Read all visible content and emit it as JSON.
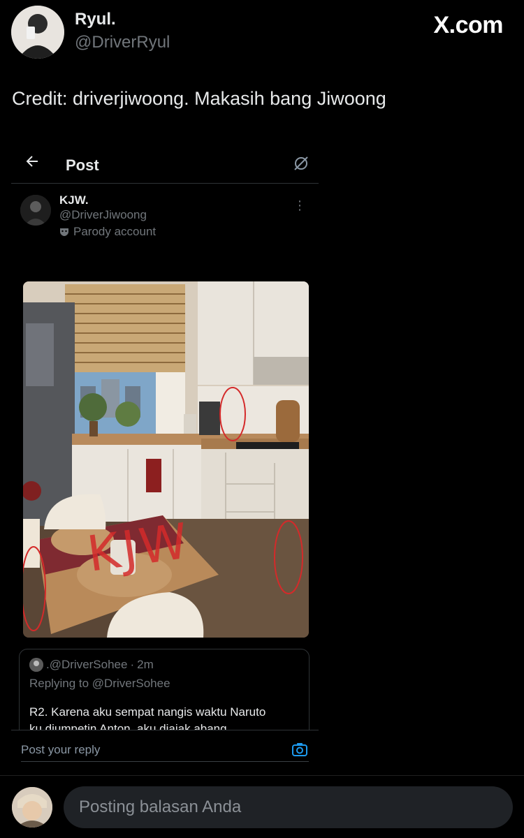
{
  "outer_tweet": {
    "display_name": "Ryul.",
    "handle": "@DriverRyul",
    "site_logo": "X.com",
    "text": "Credit: driverjiwoong. Makasih bang Jiwoong"
  },
  "embedded_post": {
    "header_title": "Post",
    "author": {
      "display_name": "KJW.",
      "handle": "@DriverJiwoong",
      "account_label": "Parody account"
    },
    "photo_annotation": "KJW",
    "quote": {
      "handle": ".@DriverSohee",
      "separator": "·",
      "time": "2m",
      "replying_to": "Replying to @DriverSohee",
      "text_line1": "R2. Karena aku sempat nangis waktu Naruto",
      "text_line2": "ku diumpetin Anton, aku diajak abang"
    },
    "reply_placeholder": "Post your reply"
  },
  "bottom_bar": {
    "reply_placeholder": "Posting balasan Anda"
  },
  "icons": [
    "back-arrow-icon",
    "grok-icon",
    "more-icon",
    "mask-icon",
    "camera-icon"
  ],
  "colors": {
    "background": "#000000",
    "primary_text": "#e7e9ea",
    "secondary_text": "#71767b",
    "accent": "#1d9bf0",
    "annotation_red": "#d42a2a"
  }
}
